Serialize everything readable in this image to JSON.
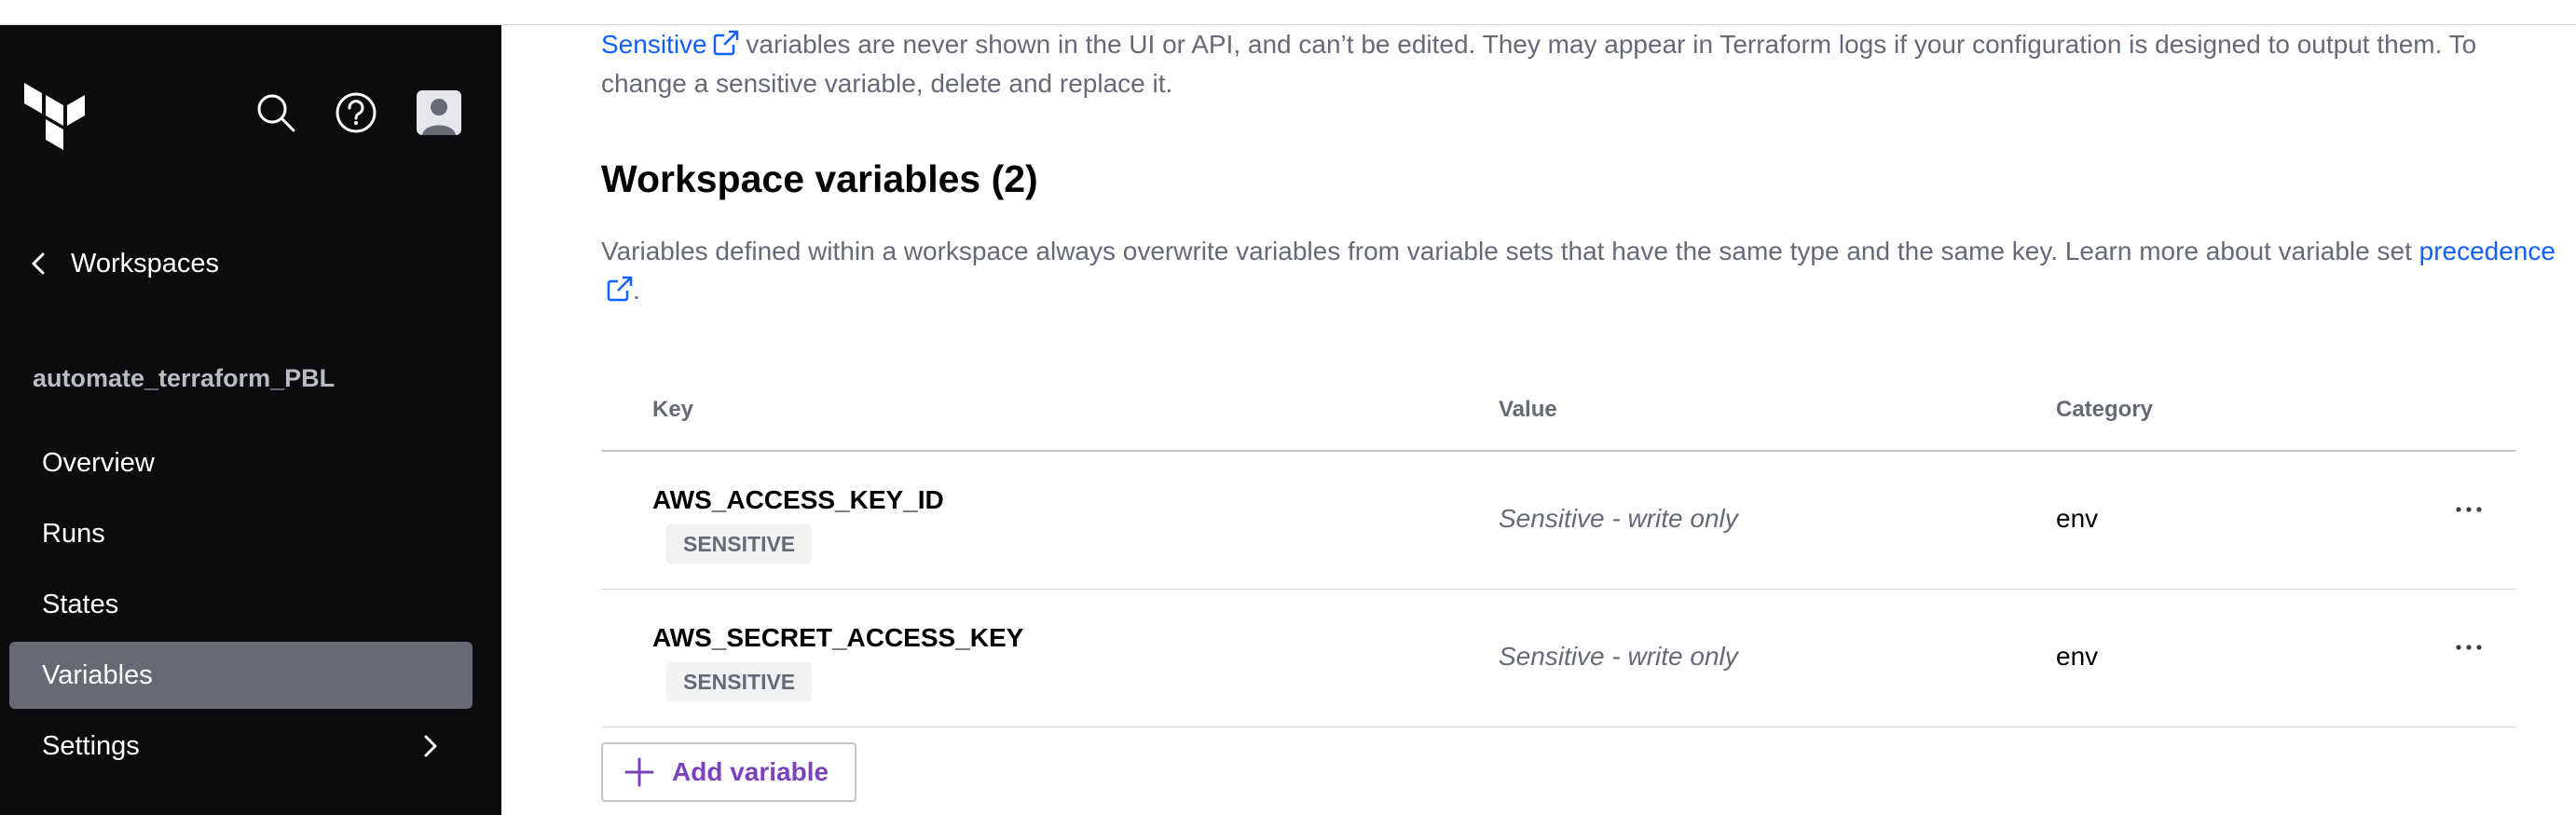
{
  "sidebar": {
    "back_label": "Workspaces",
    "workspace_name": "automate_terraform_PBL",
    "nav": [
      {
        "label": "Overview",
        "active": false
      },
      {
        "label": "Runs",
        "active": false
      },
      {
        "label": "States",
        "active": false
      },
      {
        "label": "Variables",
        "active": true
      },
      {
        "label": "Settings",
        "active": false
      }
    ],
    "icons": [
      "terraform-logo",
      "search-icon",
      "help-icon",
      "avatar"
    ]
  },
  "main": {
    "intro": {
      "link_text": "Sensitive",
      "text_after": " variables are never shown in the UI or API, and can’t be edited. They may appear in Terraform logs if your configuration is designed to output them. To change a sensitive variable, delete and replace it."
    },
    "section_title": "Workspace variables (2)",
    "description": {
      "text_before": "Variables defined within a workspace always overwrite variables from variable sets that have the same type and the same key. Learn more about variable set ",
      "link_text": "precedence",
      "text_after": "."
    },
    "table": {
      "headers": {
        "key": "Key",
        "value": "Value",
        "category": "Category"
      },
      "rows": [
        {
          "key": "AWS_ACCESS_KEY_ID",
          "badge": "SENSITIVE",
          "value": "Sensitive - write only",
          "category": "env"
        },
        {
          "key": "AWS_SECRET_ACCESS_KEY",
          "badge": "SENSITIVE",
          "value": "Sensitive - write only",
          "category": "env"
        }
      ]
    },
    "add_button_label": "Add variable"
  },
  "colors": {
    "sidebar_bg": "#0c0c0e",
    "active_item_bg": "#656a76",
    "link": "#1060ff",
    "add_button": "#7b42bc"
  }
}
